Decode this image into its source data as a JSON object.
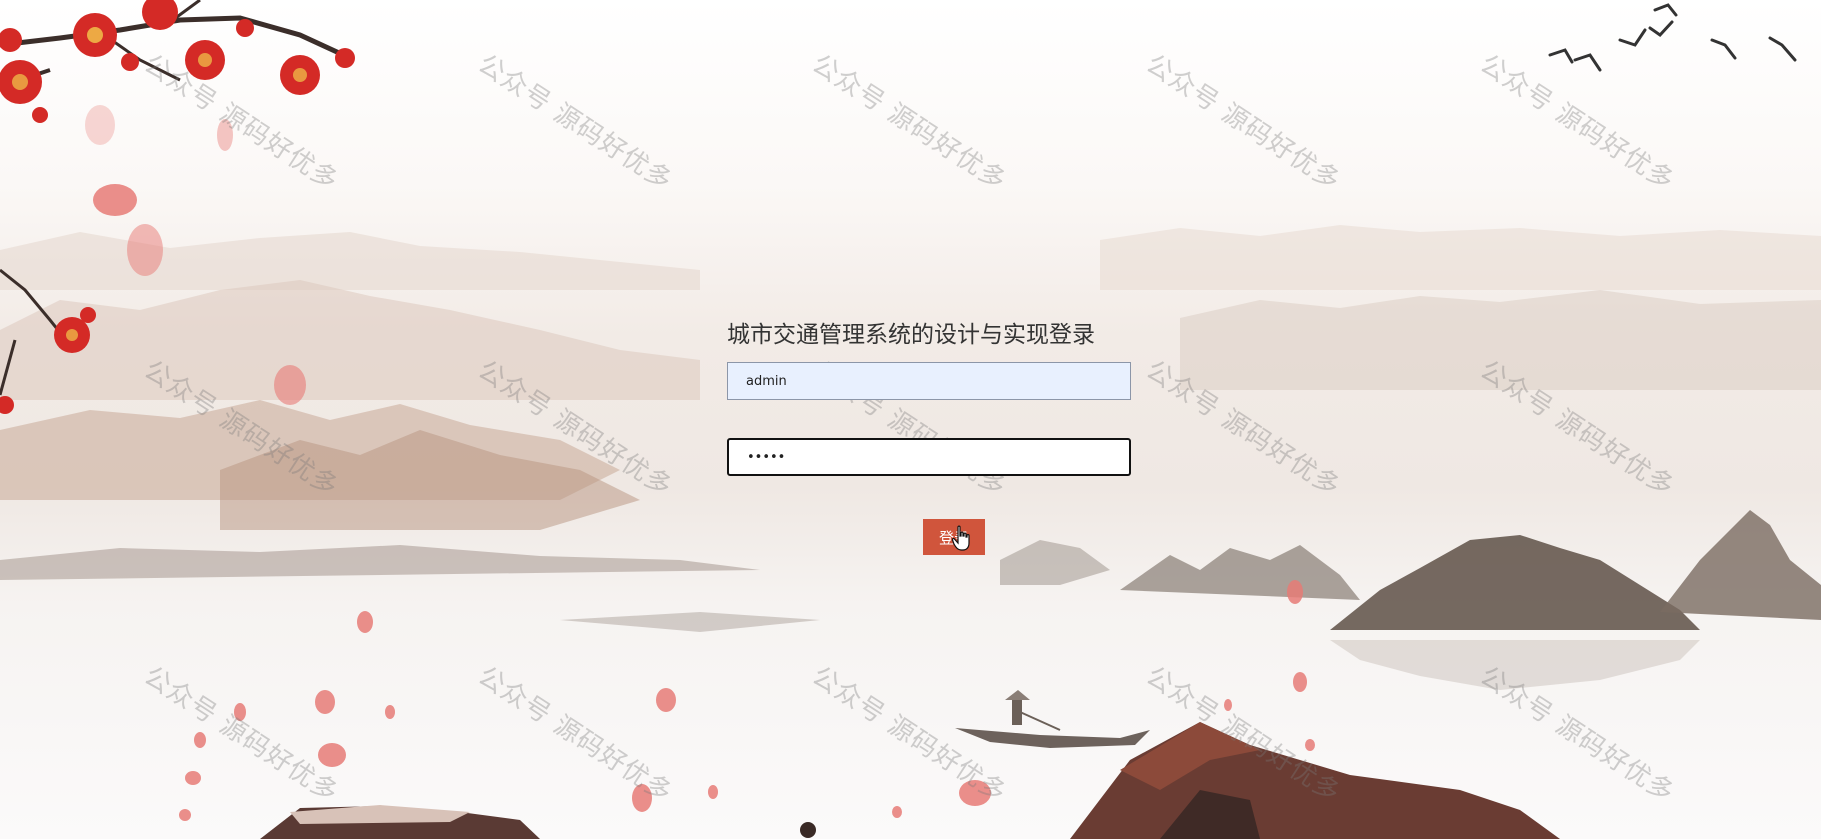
{
  "login": {
    "title": "城市交通管理系统的设计与实现登录",
    "username_value": "admin",
    "password_value": "•••••",
    "button_label": "登录"
  },
  "watermark": {
    "text": "公众号 源码好优多"
  },
  "icons": {
    "cursor": "hand-pointer-icon"
  },
  "colors": {
    "button": "#d0553c",
    "username_bg": "#e8f0fe",
    "blossom": "#d42a26"
  }
}
